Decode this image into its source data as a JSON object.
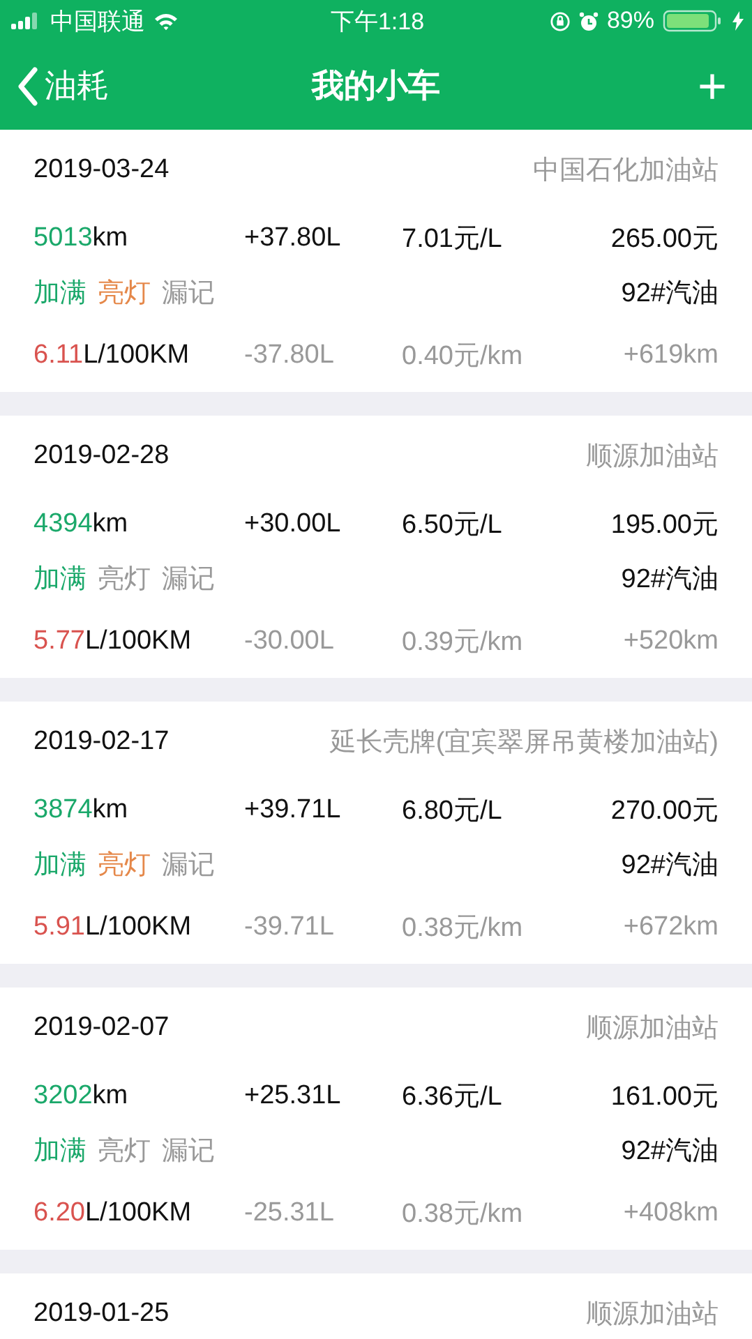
{
  "status_bar": {
    "carrier": "中国联通",
    "time": "下午1:18",
    "battery": "89%"
  },
  "nav": {
    "back": "油耗",
    "title": "我的小车",
    "add": "+"
  },
  "records": [
    {
      "date": "2019-03-24",
      "station": "中国石化加油站",
      "odometer": {
        "value": "5013",
        "unit": "km"
      },
      "volume": "+37.80L",
      "price": "7.01元/L",
      "amount": "265.00元",
      "tags": [
        {
          "label": "加满",
          "on": true
        },
        {
          "label": "亮灯",
          "on": true
        },
        {
          "label": "漏记",
          "on": false
        }
      ],
      "fuel": "92#汽油",
      "consumption": {
        "value": "6.11",
        "unit": "L/100KM"
      },
      "used": "-37.80L",
      "cost_per_km": "0.40元/km",
      "distance": "+619km"
    },
    {
      "date": "2019-02-28",
      "station": "顺源加油站",
      "odometer": {
        "value": "4394",
        "unit": "km"
      },
      "volume": "+30.00L",
      "price": "6.50元/L",
      "amount": "195.00元",
      "tags": [
        {
          "label": "加满",
          "on": true
        },
        {
          "label": "亮灯",
          "on": false
        },
        {
          "label": "漏记",
          "on": false
        }
      ],
      "fuel": "92#汽油",
      "consumption": {
        "value": "5.77",
        "unit": "L/100KM"
      },
      "used": "-30.00L",
      "cost_per_km": "0.39元/km",
      "distance": "+520km"
    },
    {
      "date": "2019-02-17",
      "station": "延长壳牌(宜宾翠屏吊黄楼加油站)",
      "odometer": {
        "value": "3874",
        "unit": "km"
      },
      "volume": "+39.71L",
      "price": "6.80元/L",
      "amount": "270.00元",
      "tags": [
        {
          "label": "加满",
          "on": true
        },
        {
          "label": "亮灯",
          "on": true
        },
        {
          "label": "漏记",
          "on": false
        }
      ],
      "fuel": "92#汽油",
      "consumption": {
        "value": "5.91",
        "unit": "L/100KM"
      },
      "used": "-39.71L",
      "cost_per_km": "0.38元/km",
      "distance": "+672km"
    },
    {
      "date": "2019-02-07",
      "station": "顺源加油站",
      "odometer": {
        "value": "3202",
        "unit": "km"
      },
      "volume": "+25.31L",
      "price": "6.36元/L",
      "amount": "161.00元",
      "tags": [
        {
          "label": "加满",
          "on": true
        },
        {
          "label": "亮灯",
          "on": false
        },
        {
          "label": "漏记",
          "on": false
        }
      ],
      "fuel": "92#汽油",
      "consumption": {
        "value": "6.20",
        "unit": "L/100KM"
      },
      "used": "-25.31L",
      "cost_per_km": "0.38元/km",
      "distance": "+408km"
    },
    {
      "date": "2019-01-25",
      "station": "顺源加油站"
    }
  ]
}
